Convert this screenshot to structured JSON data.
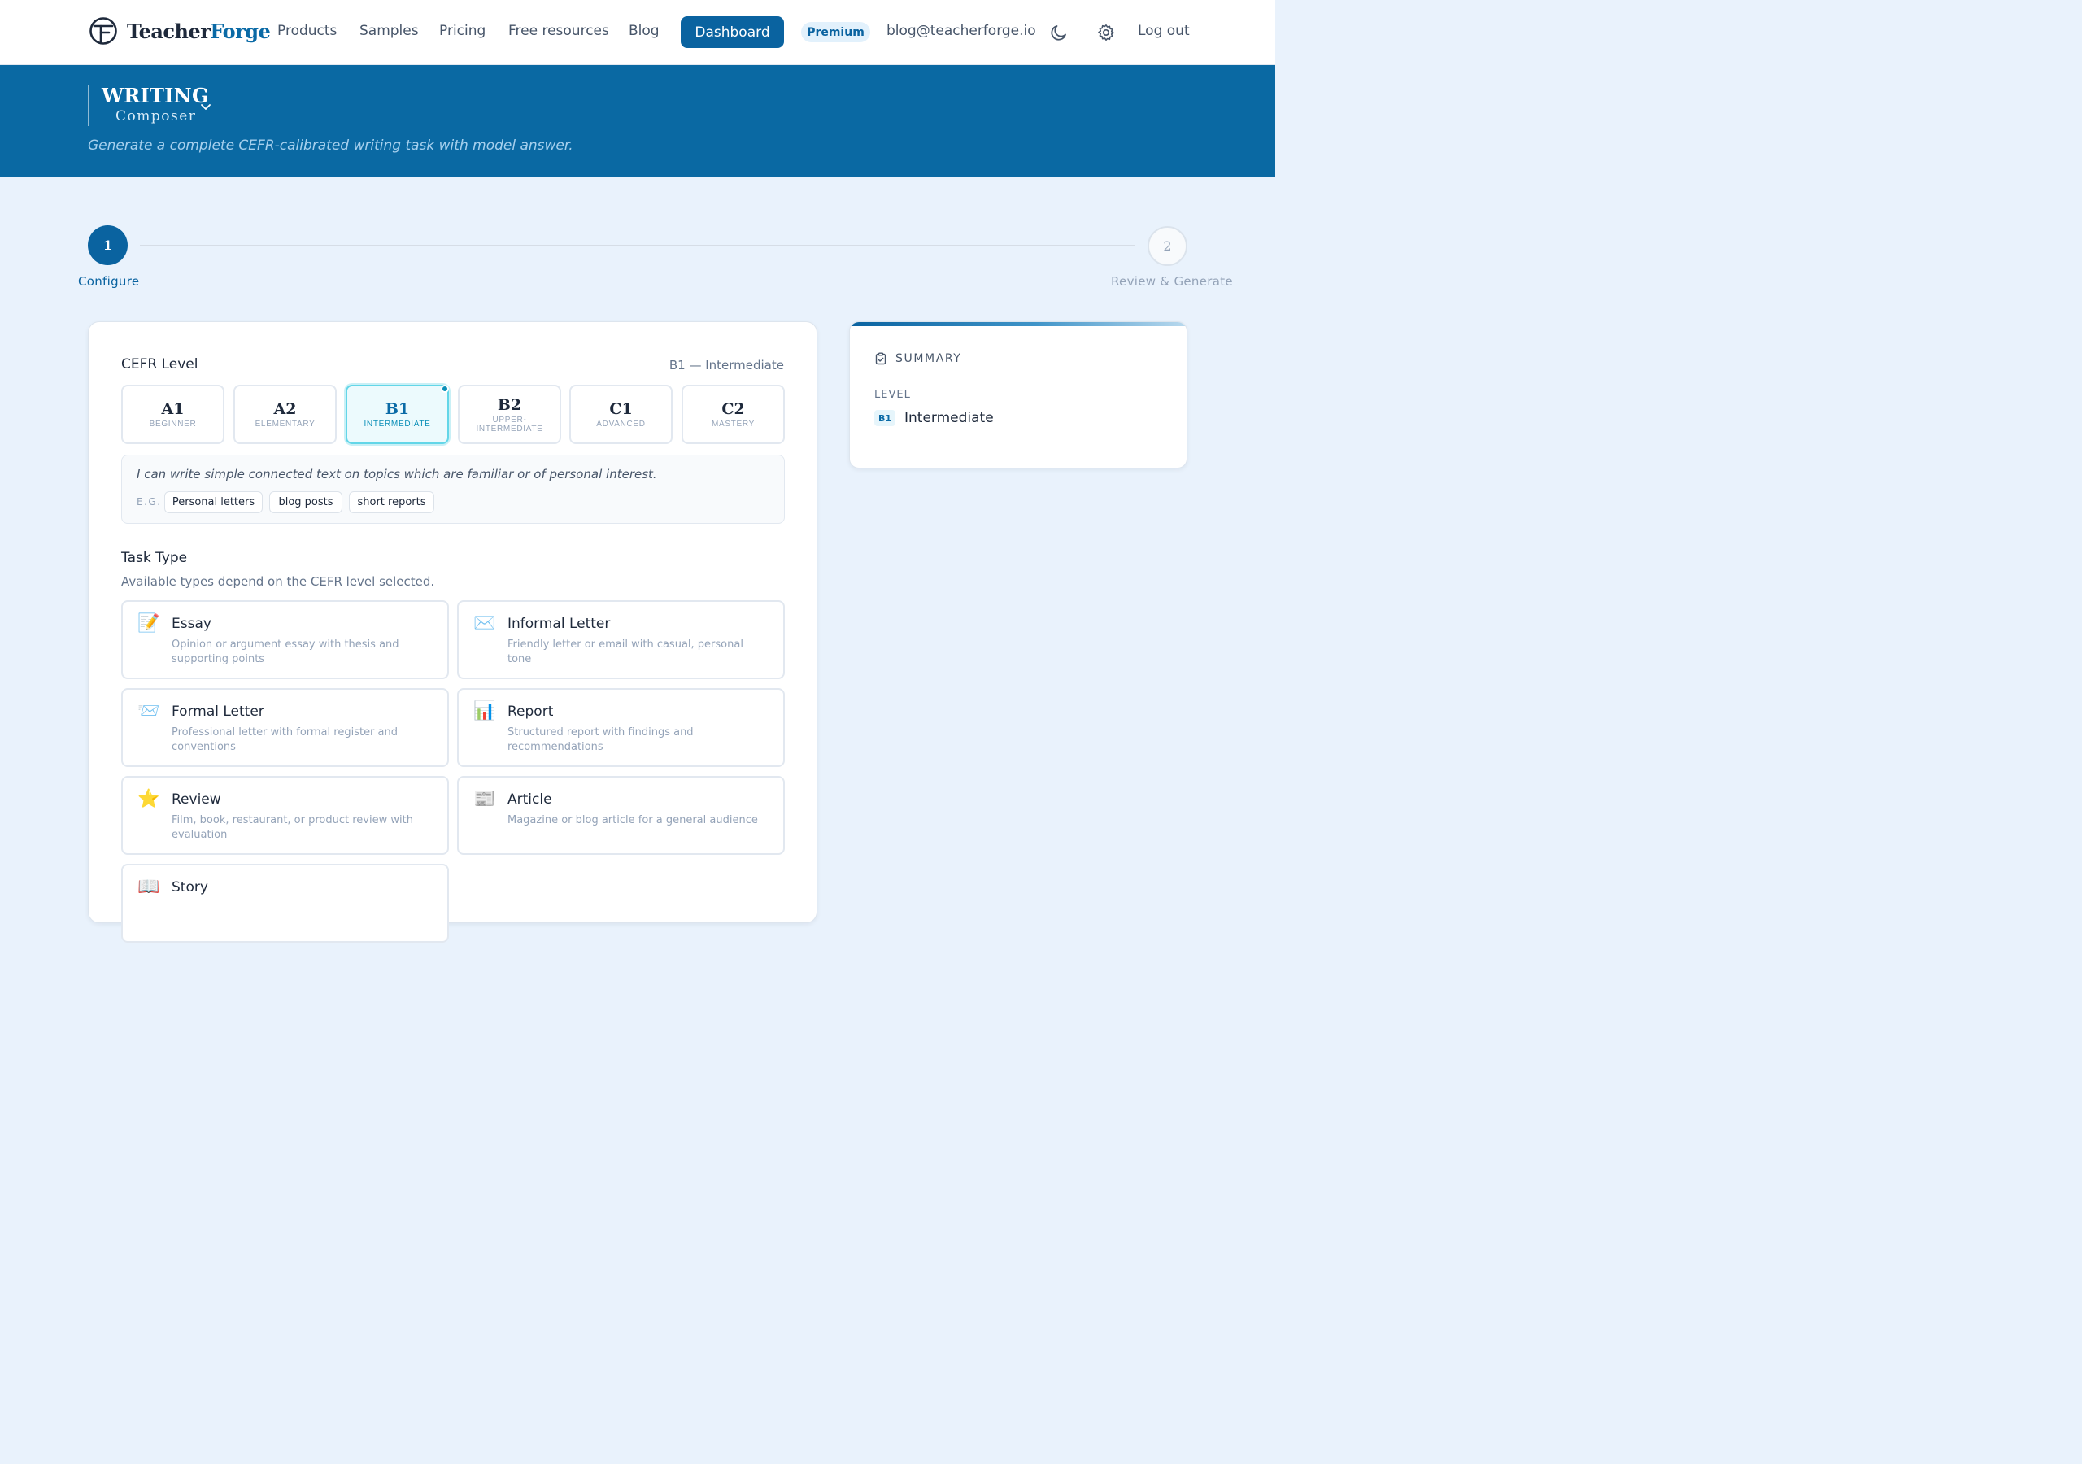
{
  "nav": {
    "brand_part1": "Teacher",
    "brand_part2": "Forge",
    "links": [
      "Products",
      "Samples",
      "Pricing",
      "Free resources",
      "Blog"
    ],
    "dashboard_label": "Dashboard",
    "premium_label": "Premium",
    "email": "blog@teacherforge.io",
    "logout_label": "Log out",
    "icons": [
      "moon-icon",
      "gear-icon"
    ]
  },
  "hero": {
    "title": "WRITING",
    "subtitle": "Composer",
    "description": "Generate a complete CEFR-calibrated writing task with model answer."
  },
  "stepper": {
    "steps": [
      {
        "number": "1",
        "label": "Configure",
        "state": "active"
      },
      {
        "number": "2",
        "label": "Review & Generate",
        "state": "inactive"
      }
    ]
  },
  "cefr": {
    "title": "CEFR Level",
    "selected_display": "B1 — Intermediate",
    "levels": [
      {
        "code": "A1",
        "name": "Beginner"
      },
      {
        "code": "A2",
        "name": "Elementary"
      },
      {
        "code": "B1",
        "name": "Intermediate",
        "selected": true
      },
      {
        "code": "B2",
        "name": "Upper-Intermediate"
      },
      {
        "code": "C1",
        "name": "Advanced"
      },
      {
        "code": "C2",
        "name": "Mastery"
      }
    ],
    "description": "I can write simple connected text on topics which are familiar or of personal interest.",
    "examples_label": "E.G.",
    "examples": [
      "Personal letters",
      "blog posts",
      "short reports"
    ]
  },
  "task_type": {
    "title": "Task Type",
    "help": "Available types depend on the CEFR level selected.",
    "types": [
      {
        "icon": "📝",
        "icon_name": "memo-icon",
        "title": "Essay",
        "description": "Opinion or argument essay with thesis and supporting points"
      },
      {
        "icon": "✉️",
        "icon_name": "envelope-icon",
        "title": "Informal Letter",
        "description": "Friendly letter or email with casual, personal tone"
      },
      {
        "icon": "📨",
        "icon_name": "incoming-envelope-icon",
        "title": "Formal Letter",
        "description": "Professional letter with formal register and conventions"
      },
      {
        "icon": "📊",
        "icon_name": "bar-chart-icon",
        "title": "Report",
        "description": "Structured report with findings and recommendations"
      },
      {
        "icon": "⭐",
        "icon_name": "star-icon",
        "title": "Review",
        "description": "Film, book, restaurant, or product review with evaluation"
      },
      {
        "icon": "📰",
        "icon_name": "newspaper-icon",
        "title": "Article",
        "description": "Magazine or blog article for a general audience"
      },
      {
        "icon": "📖",
        "icon_name": "open-book-icon",
        "title": "Story",
        "description": ""
      }
    ]
  },
  "summary": {
    "title": "SUMMARY",
    "level_label": "LEVEL",
    "level_code": "B1",
    "level_value": "Intermediate"
  },
  "colors": {
    "primary": "#0a63a0",
    "hero_bg": "#0a69a3",
    "page_bg": "#e9f2fc",
    "accent_cyan": "#63d6e8"
  }
}
